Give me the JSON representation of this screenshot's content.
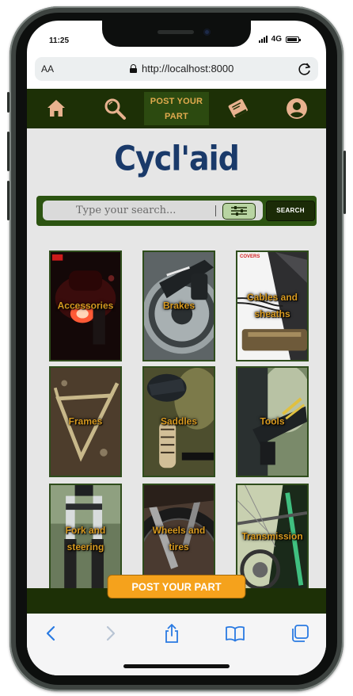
{
  "status_bar": {
    "time": "11:25",
    "network": "4G",
    "battery_level": 0.9
  },
  "browser": {
    "aa_label": "AA",
    "url": "http://localhost:8000"
  },
  "nav": {
    "post_part_label": "POST YOUR PART"
  },
  "brand": {
    "title": "Cycl'aid"
  },
  "search": {
    "placeholder": "Type your search...",
    "button_label": "SEARCH"
  },
  "categories": [
    {
      "label": "Accessories"
    },
    {
      "label": "Brakes"
    },
    {
      "label": "Cables and sheaths",
      "badge": "COVERS"
    },
    {
      "label": "Frames"
    },
    {
      "label": "Saddles"
    },
    {
      "label": "Tools"
    },
    {
      "label": "Fork and steering"
    },
    {
      "label": "Wheels and tires"
    },
    {
      "label": "Transmission"
    }
  ],
  "footer": {
    "post_button_label": "POST YOUR PART"
  },
  "colors": {
    "header_bg": "#1d3006",
    "accent_orange": "#f5a21c",
    "brand_blue": "#1a3a6a",
    "tile_label": "#d89a20",
    "page_bg": "#e6e6e6"
  },
  "icons": [
    "home-icon",
    "search-icon",
    "book-icon",
    "user-icon",
    "back-icon",
    "forward-icon",
    "share-icon",
    "bookmarks-icon",
    "tabs-icon",
    "lock-icon",
    "reload-icon",
    "filter-icon"
  ]
}
